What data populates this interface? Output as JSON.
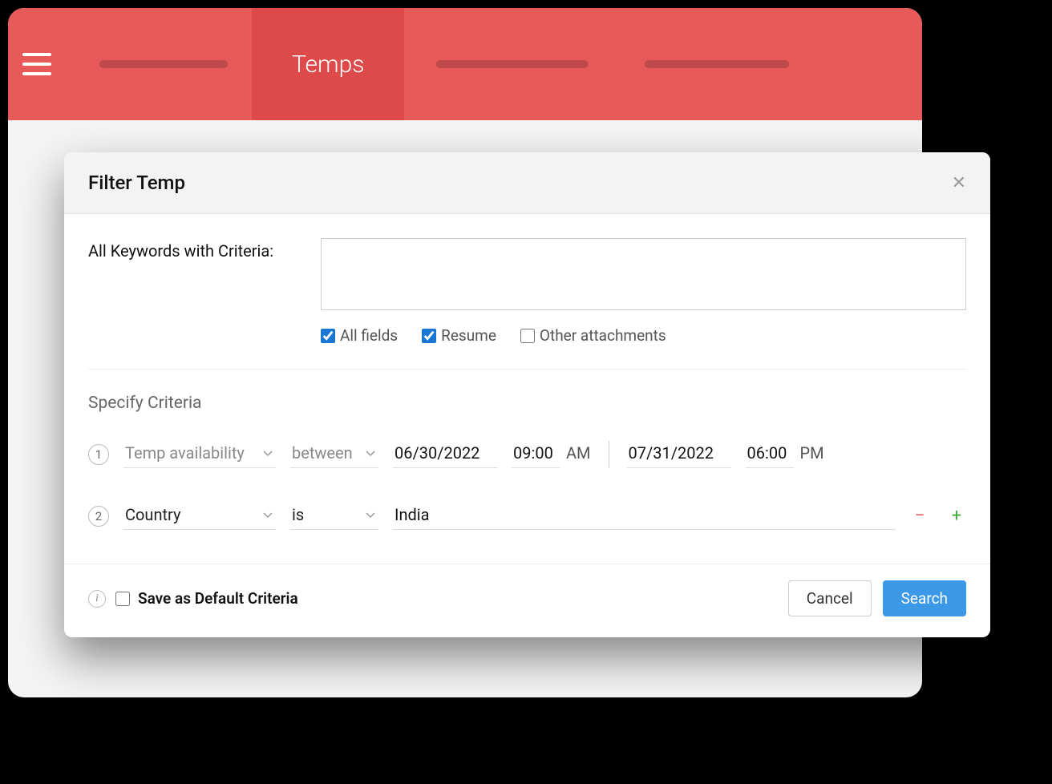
{
  "header": {
    "active_tab_label": "Temps"
  },
  "modal": {
    "title": "Filter Temp",
    "keywords": {
      "label": "All Keywords with Criteria:",
      "value": "",
      "checks": {
        "all_fields": {
          "label": "All fields",
          "checked": true
        },
        "resume": {
          "label": "Resume",
          "checked": true
        },
        "other_attachments": {
          "label": "Other attachments",
          "checked": false
        }
      }
    },
    "specify_title": "Specify Criteria",
    "criteria": [
      {
        "index": "1",
        "field": "Temp availability",
        "operator": "between",
        "from_date": "06/30/2022",
        "from_time": "09:00",
        "from_ampm": "AM",
        "to_date": "07/31/2022",
        "to_time": "06:00",
        "to_ampm": "PM"
      },
      {
        "index": "2",
        "field": "Country",
        "operator": "is",
        "value": "India"
      }
    ],
    "footer": {
      "save_default_label": "Save as Default Criteria",
      "cancel_label": "Cancel",
      "search_label": "Search"
    }
  }
}
